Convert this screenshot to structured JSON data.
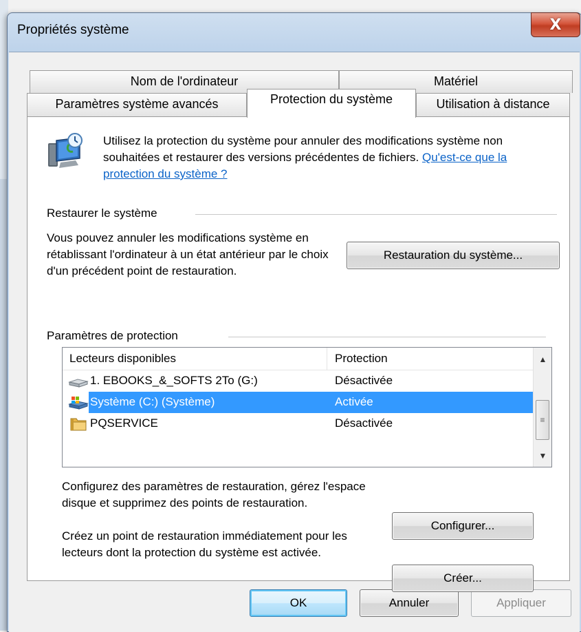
{
  "window": {
    "title": "Propriétés système",
    "close_symbol": "X"
  },
  "tabs": {
    "row1": [
      "Nom de l'ordinateur",
      "Matériel"
    ],
    "row2": [
      "Paramètres système avancés",
      "Protection du système",
      "Utilisation à distance"
    ],
    "active": "Protection du système"
  },
  "intro": {
    "icon": "system-protection-icon",
    "text": "Utilisez la protection du système pour annuler des modifications système non souhaitées et restaurer des versions précédentes de fichiers.",
    "link": "Qu'est-ce que la protection du système ?"
  },
  "restore": {
    "group_label": "Restaurer le système",
    "description": "Vous pouvez annuler les modifications système en rétablissant l'ordinateur à un état antérieur par le choix d'un précédent point de restauration.",
    "button": "Restauration du système..."
  },
  "protection": {
    "group_label": "Paramètres de protection",
    "columns": [
      "Lecteurs disponibles",
      "Protection"
    ],
    "drives": [
      {
        "name": "1. EBOOKS_&_SOFTS  2To (G:)",
        "protection": "Désactivée",
        "icon": "drive-icon",
        "selected": false
      },
      {
        "name": "Système (C:) (Système)",
        "protection": "Activée",
        "icon": "system-drive-icon",
        "selected": true
      },
      {
        "name": "PQSERVICE",
        "protection": "Désactivée",
        "icon": "folder-drive-icon",
        "selected": false
      }
    ],
    "configure_text": "Configurez des paramètres de restauration, gérez l'espace disque et supprimez des points de restauration.",
    "configure_button": "Configurer...",
    "create_text": "Créez un point de restauration immédiatement pour les lecteurs dont la protection du système est activée.",
    "create_button": "Créer..."
  },
  "footer": {
    "ok": "OK",
    "cancel": "Annuler",
    "apply": "Appliquer"
  }
}
